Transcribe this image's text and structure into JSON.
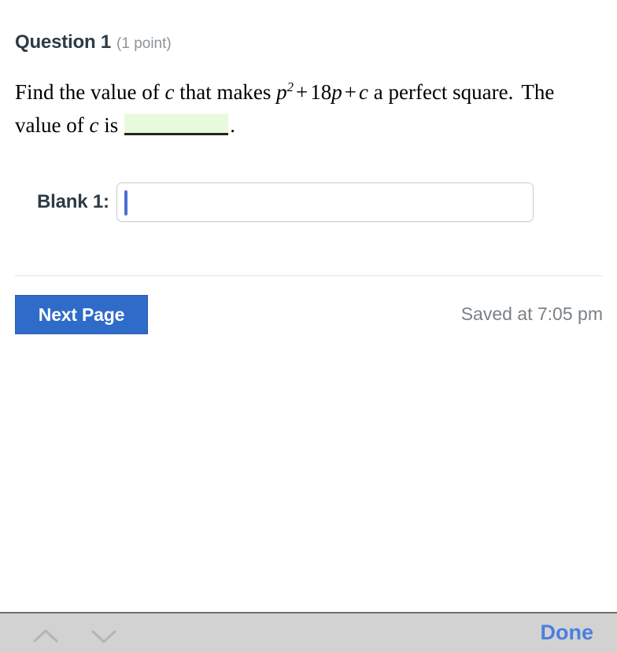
{
  "question": {
    "title": "Question 1",
    "points": "(1 point)",
    "prompt": {
      "lead": "Find the value of",
      "var1": "c",
      "mid": "that makes",
      "expression": {
        "base": "p",
        "exponent": "2",
        "plus1": "+",
        "coefficient": "18",
        "variable": "p",
        "plus2": "+",
        "constant": "c"
      },
      "tail": "a perfect square.",
      "second_line_a": "The value of",
      "var2": "c",
      "second_line_b": "is",
      "blank_value": "",
      "period": "."
    }
  },
  "blank_field": {
    "label": "Blank 1:",
    "value": "",
    "placeholder": ""
  },
  "footer": {
    "next_page_label": "Next Page",
    "saved_status": "Saved at 7:05 pm"
  },
  "accessory_bar": {
    "prev_icon": "chevron-up-icon",
    "next_icon": "chevron-down-icon",
    "done_label": "Done"
  },
  "colors": {
    "accent_blue": "#2f6bc8",
    "done_blue": "#4a7fe0",
    "blank_green": "#e7fadb",
    "muted_text": "#8d9399",
    "bar_background": "#d2d2d2"
  }
}
